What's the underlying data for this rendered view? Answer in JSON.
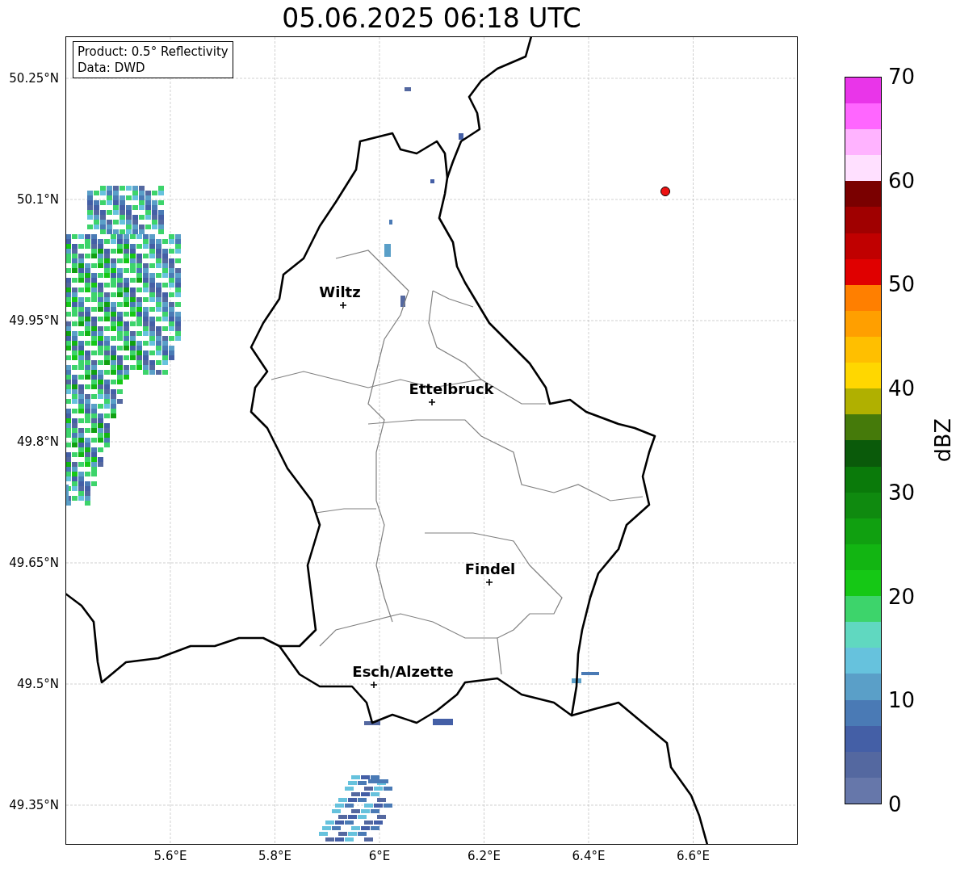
{
  "title": "05.06.2025 06:18 UTC",
  "info_box": {
    "lines": [
      "Product: 0.5° Reflectivity",
      "Data: DWD"
    ]
  },
  "y_ticks": [
    "50.25°N",
    "50.1°N",
    "49.95°N",
    "49.8°N",
    "49.65°N",
    "49.5°N",
    "49.35°N"
  ],
  "x_ticks": [
    "5.6°E",
    "5.8°E",
    "6°E",
    "6.2°E",
    "6.4°E",
    "6.6°E"
  ],
  "cities": [
    {
      "name": "Wiltz"
    },
    {
      "name": "Ettelbruck"
    },
    {
      "name": "Findel"
    },
    {
      "name": "Esch/Alzette"
    }
  ],
  "colorbar": {
    "label": "dBZ",
    "ticks": [
      "70",
      "60",
      "50",
      "40",
      "30",
      "20",
      "10",
      "0"
    ],
    "bins": [
      {
        "color": "#6677aa"
      },
      {
        "color": "#5468a0"
      },
      {
        "color": "#445fa6"
      },
      {
        "color": "#4a7ab5"
      },
      {
        "color": "#5a9fc8"
      },
      {
        "color": "#66c2dd"
      },
      {
        "color": "#60d8c0"
      },
      {
        "color": "#3dd46b"
      },
      {
        "color": "#15c815"
      },
      {
        "color": "#12b512"
      },
      {
        "color": "#10a010"
      },
      {
        "color": "#0f8a0f"
      },
      {
        "color": "#0a7a0a"
      },
      {
        "color": "#0a5a0a"
      },
      {
        "color": "#457a0a"
      },
      {
        "color": "#b0b000"
      },
      {
        "color": "#ffd700"
      },
      {
        "color": "#ffbf00"
      },
      {
        "color": "#ff9f00"
      },
      {
        "color": "#ff7f00"
      },
      {
        "color": "#e00000"
      },
      {
        "color": "#c00000"
      },
      {
        "color": "#a00000"
      },
      {
        "color": "#7a0000"
      },
      {
        "color": "#ffe0ff"
      },
      {
        "color": "#ffb3ff"
      },
      {
        "color": "#ff66ff"
      },
      {
        "color": "#e935e9"
      }
    ]
  }
}
